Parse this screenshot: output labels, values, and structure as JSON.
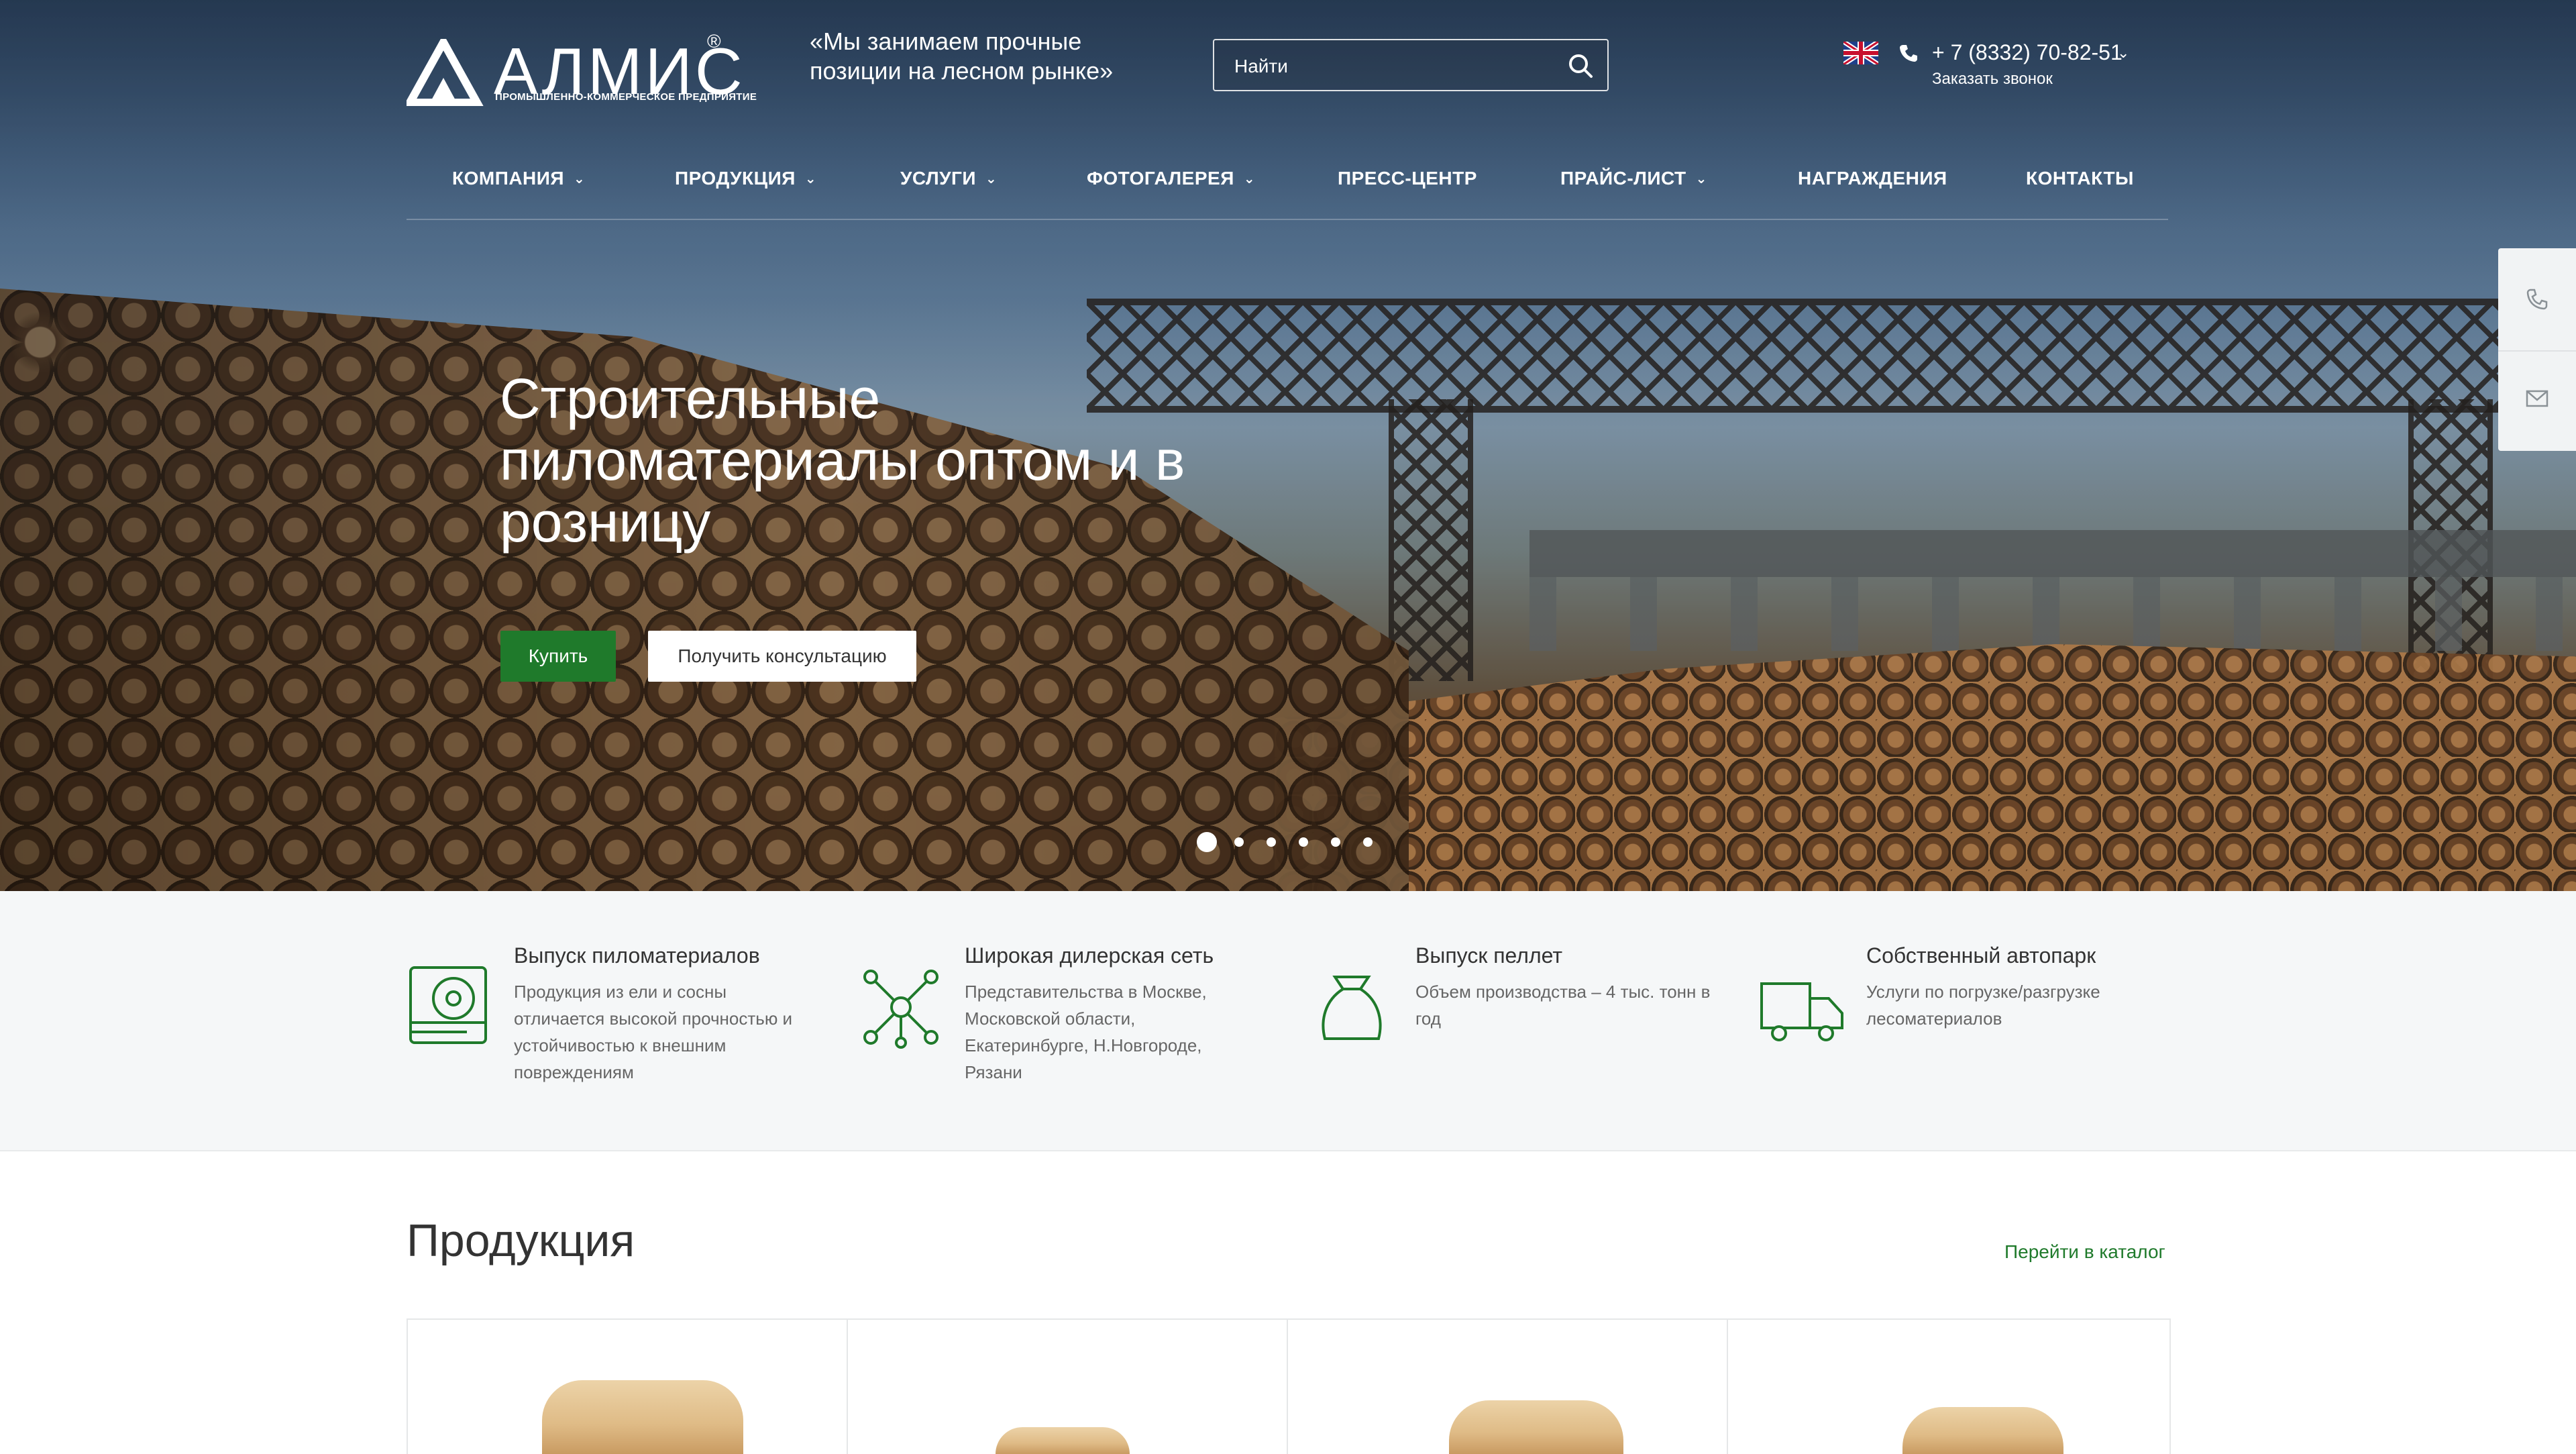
{
  "header": {
    "logo_name": "АЛМИС",
    "logo_reg": "®",
    "logo_sub": "ПРОМЫШЛЕННО-КОММЕРЧЕСКОЕ ПРЕДПРИЯТИЕ",
    "slogan": "«Мы занимаем прочные позиции на лесном рынке»",
    "search_placeholder": "Найти",
    "phone": "+ 7 (8332) 70-82-51",
    "phone_caret": "⌄",
    "callback": "Заказать звонок"
  },
  "nav": {
    "items": [
      {
        "label": "КОМПАНИЯ",
        "dropdown": true
      },
      {
        "label": "ПРОДУКЦИЯ",
        "dropdown": true
      },
      {
        "label": "УСЛУГИ",
        "dropdown": true
      },
      {
        "label": "ФОТОГАЛЕРЕЯ",
        "dropdown": true
      },
      {
        "label": "ПРЕСС-ЦЕНТР",
        "dropdown": false
      },
      {
        "label": "ПРАЙС-ЛИСТ",
        "dropdown": true
      },
      {
        "label": "НАГРАЖДЕНИЯ",
        "dropdown": false
      },
      {
        "label": "КОНТАКТЫ",
        "dropdown": false
      }
    ],
    "chevron": "⌄"
  },
  "hero": {
    "title": "Строительные пиломатериалы оптом и в розницу",
    "buy_label": "Купить",
    "consult_label": "Получить консультацию",
    "slides_total": 6,
    "active_slide": 1
  },
  "features": [
    {
      "title": "Выпуск пиломатериалов",
      "desc": "Продукция из ели и сосны отличается высокой прочностью и устойчивостью к внешним повреждениям",
      "icon": "sawmill-icon"
    },
    {
      "title": "Широкая дилерская сеть",
      "desc": "Представительства в Москве, Московской области, Екатеринбурге, Н.Новгороде, Рязани",
      "icon": "network-icon"
    },
    {
      "title": "Выпуск пеллет",
      "desc": "Объем производства – 4 тыс. тонн в год",
      "icon": "sack-icon"
    },
    {
      "title": "Собственный автопарк",
      "desc": "Услуги по погрузке/разгрузке лесоматериалов",
      "icon": "truck-icon"
    }
  ],
  "products": {
    "title": "Продукция",
    "catalog_link": "Перейти в каталог"
  },
  "colors": {
    "accent": "#1f7a2b",
    "features_bg": "#f5f7f8"
  }
}
